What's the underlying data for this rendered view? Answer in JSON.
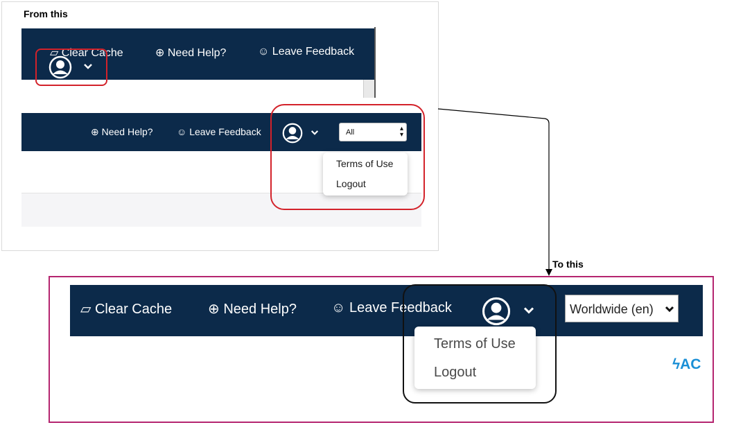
{
  "labels": {
    "from": "From this",
    "to": "To this"
  },
  "before": {
    "top_nav": {
      "clear_cache": "Clear Cache",
      "need_help": "Need Help?",
      "leave_feedback": "Leave Feedback"
    },
    "second_nav": {
      "need_help": "Need Help?",
      "leave_feedback": "Leave Feedback",
      "region_select_value": "All",
      "dropdown": [
        "Terms of Use",
        "Logout"
      ]
    }
  },
  "after": {
    "nav": {
      "clear_cache": "Clear Cache",
      "need_help": "Need Help?",
      "leave_feedback": "Leave Feedback",
      "region_select_value": "Worldwide (en)",
      "dropdown": [
        "Terms of Use",
        "Logout"
      ],
      "cut_off_link": "AC"
    }
  },
  "icons": {
    "eraser": "eraser-icon",
    "lifebuoy": "lifebuoy-icon",
    "smile": "smile-icon",
    "user": "user-circle-icon",
    "chevron": "chevron-down-icon",
    "bolt": "bolt-icon"
  },
  "colors": {
    "navy": "#0c2a4a",
    "highlight_red": "#d3222a",
    "highlight_magenta": "#b5246f",
    "link_blue": "#1a8fd6"
  }
}
